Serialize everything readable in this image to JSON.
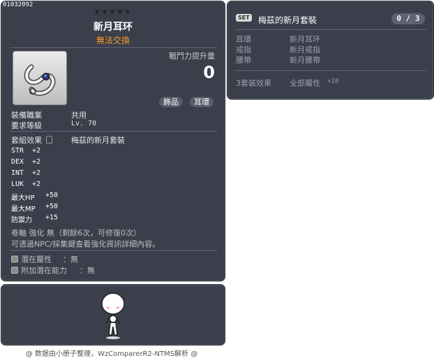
{
  "item": {
    "id": "01032092",
    "stars": "★★★★★",
    "name": "新月耳环",
    "trade_note": "無法交換",
    "power_label": "戰鬥力提升量",
    "power_value": "0",
    "tags": [
      "飾品",
      "耳環"
    ],
    "job_label": "裝備職業",
    "job_value": "共用",
    "level_label": "要求等級",
    "level_value": "Lv. 70",
    "set_label": "套組效果",
    "set_value": "梅茲的新月套裝",
    "stats": [
      {
        "name": "STR",
        "value": "+2"
      },
      {
        "name": "DEX",
        "value": "+2"
      },
      {
        "name": "INT",
        "value": "+2"
      },
      {
        "name": "LUK",
        "value": "+2"
      },
      {
        "name": "最大HP",
        "value": "+50"
      },
      {
        "name": "最大MP",
        "value": "+50"
      },
      {
        "name": "防禦力",
        "value": "+15"
      }
    ],
    "scroll_text": "卷軸 強化 無（剩餘6次，可修復0次）",
    "hint_text": "可透過NPC/採集鍵查看強化資訊詳細內容。",
    "potential_label": "潛在屬性",
    "potential_value": "：無",
    "bonus_potential_label": "附加潛在能力",
    "bonus_potential_value": "：無"
  },
  "set_panel": {
    "badge": "SET",
    "title": "梅茲的新月套裝",
    "count": "0 / 3",
    "pieces": [
      {
        "slot": "耳環",
        "name": "新月耳环"
      },
      {
        "slot": "戒指",
        "name": "新月戒指"
      },
      {
        "slot": "腰帶",
        "name": "新月腰帶"
      }
    ],
    "effect_label": "3套裝效果",
    "effect_attr": "全部屬性",
    "effect_bonus": "+10"
  },
  "footer": "@ 数据由小册子整理，WzComparerR2-NTMS解析 @",
  "icons": [
    "earring-icon",
    "character-avatar",
    "lock-icon"
  ]
}
